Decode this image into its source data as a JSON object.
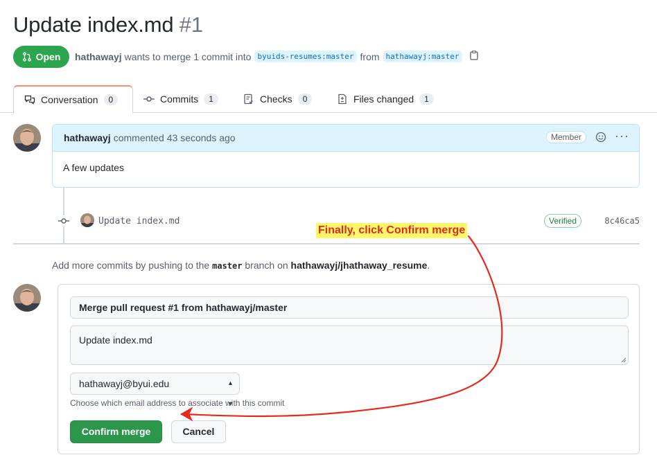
{
  "pr": {
    "title": "Update index.md",
    "number": "#1",
    "state": "Open",
    "author": "hathawayj",
    "merge_text": "wants to merge 1 commit into",
    "base_branch": "byuids-resumes:master",
    "from_text": "from",
    "head_branch": "hathawayj:master"
  },
  "tabs": [
    {
      "label": "Conversation",
      "count": "0",
      "icon": "comment-discussion-icon"
    },
    {
      "label": "Commits",
      "count": "1",
      "icon": "git-commit-icon"
    },
    {
      "label": "Checks",
      "count": "0",
      "icon": "checklist-icon"
    },
    {
      "label": "Files changed",
      "count": "1",
      "icon": "file-diff-icon"
    }
  ],
  "comment": {
    "author": "hathawayj",
    "meta": "commented 43 seconds ago",
    "role": "Member",
    "body": "A few updates"
  },
  "commit": {
    "message": "Update index.md",
    "verified": "Verified",
    "sha": "8c46ca5"
  },
  "annotation": "Finally, click Confirm merge",
  "hint": {
    "prefix": "Add more commits by pushing to the",
    "branch": "master",
    "middle": "branch on",
    "repo": "hathawayj/jhathaway_resume",
    "suffix": "."
  },
  "merge": {
    "title_value": "Merge pull request #1 from hathawayj/master",
    "description_value": "Update index.md",
    "email_selected": "hathawayj@byui.edu",
    "email_hint": "Choose which email address to associate with this commit",
    "confirm_label": "Confirm merge",
    "cancel_label": "Cancel"
  },
  "colors": {
    "open_green": "#2da44e",
    "annotation_red": "#e0291f",
    "annotation_yellow": "#fff76a"
  }
}
